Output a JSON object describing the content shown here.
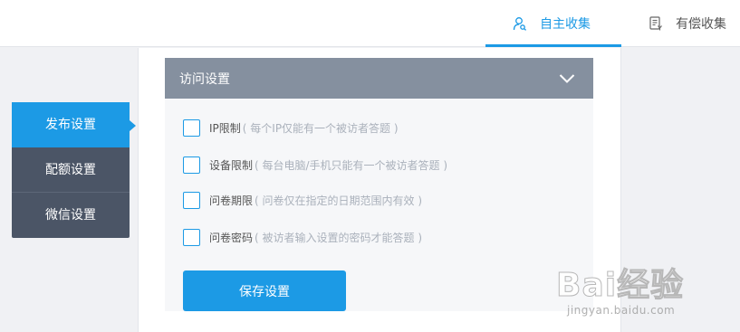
{
  "topbar": {
    "tabs": [
      {
        "label": "自主收集",
        "icon": "user-search-icon",
        "active": true
      },
      {
        "label": "有偿收集",
        "icon": "paid-document-icon",
        "active": false
      }
    ]
  },
  "sidebar": {
    "items": [
      {
        "label": "发布设置",
        "active": true
      },
      {
        "label": "配额设置",
        "active": false
      },
      {
        "label": "微信设置",
        "active": false
      }
    ]
  },
  "section": {
    "title": "访问设置",
    "toggle_icon": "chevron-down-icon",
    "options": [
      {
        "label": "IP限制",
        "hint": "( 每个IP仅能有一个被访者答题 )",
        "checked": false
      },
      {
        "label": "设备限制",
        "hint": "( 每台电脑/手机只能有一个被访者答题 )",
        "checked": false
      },
      {
        "label": "问卷期限",
        "hint": "( 问卷仅在指定的日期范围内有效 )",
        "checked": false
      },
      {
        "label": "问卷密码",
        "hint": "( 被访者输入设置的密码才能答题 )",
        "checked": false
      }
    ],
    "save_label": "保存设置"
  },
  "watermark": {
    "logo_text": "Bai经验",
    "url": "jingyan.baidu.com"
  },
  "colors": {
    "accent": "#1c9ae5",
    "nav_bg": "#4b5566",
    "section_header": "#85909f",
    "page_bg": "#f0f1f4"
  }
}
